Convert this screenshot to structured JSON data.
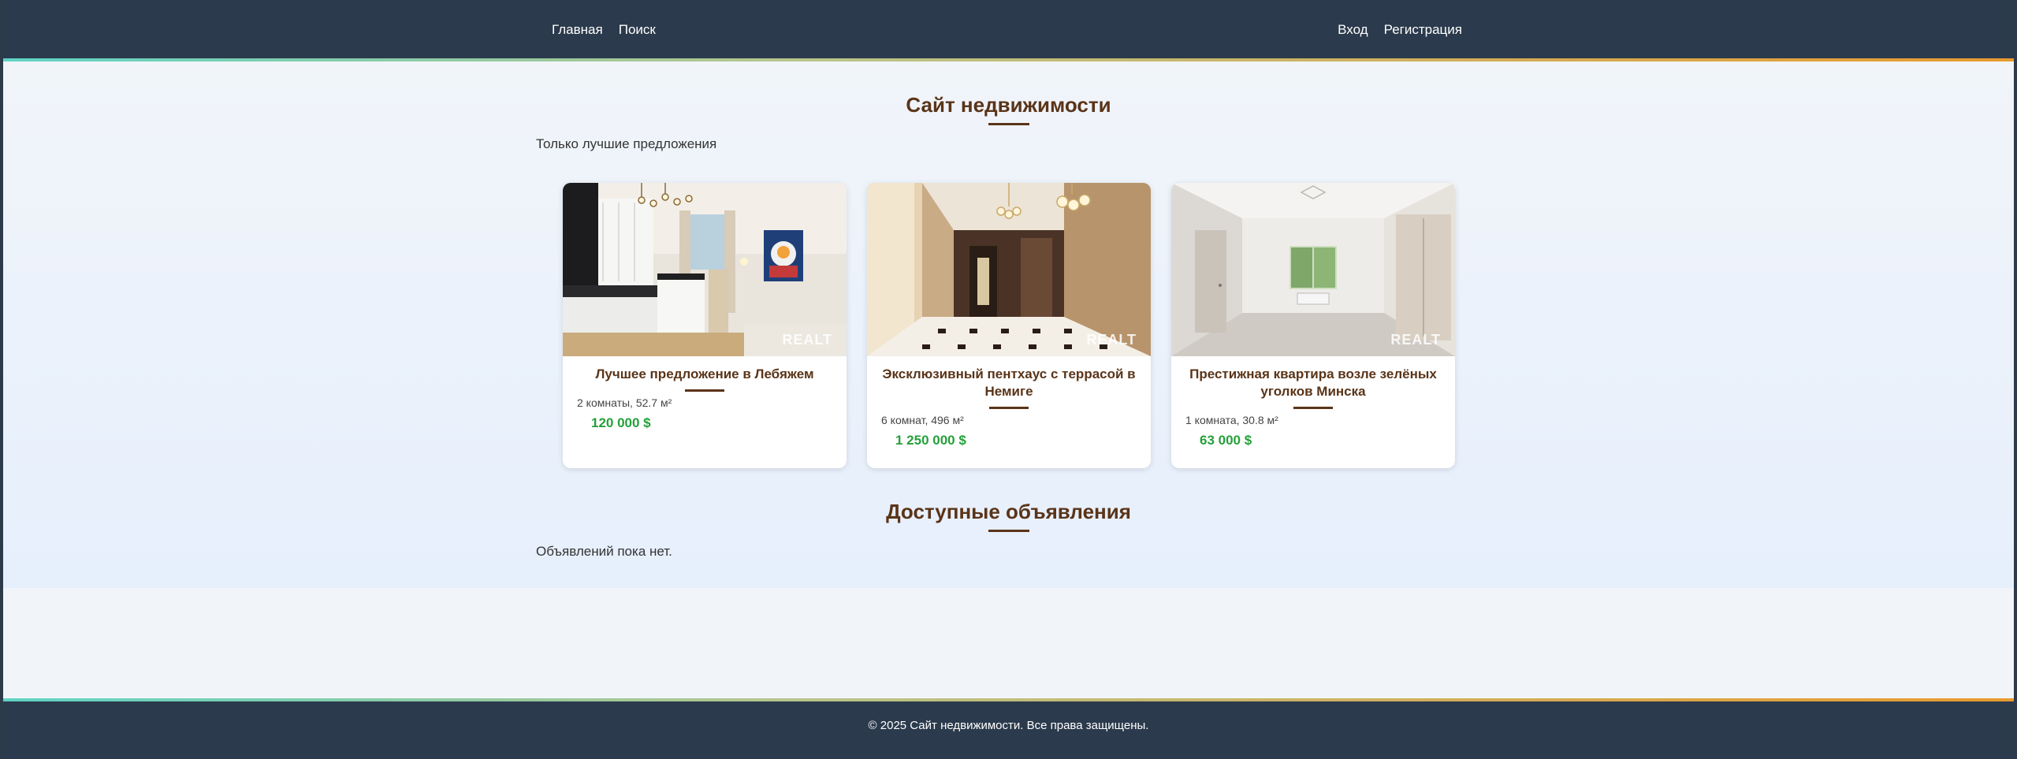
{
  "nav": {
    "home": "Главная",
    "search": "Поиск",
    "login": "Вход",
    "register": "Регистрация"
  },
  "hero": {
    "title": "Сайт недвижимости",
    "subtitle": "Только лучшие предложения"
  },
  "cards": [
    {
      "title": "Лучшее предложение в Лебяжем",
      "info": "2 комнаты, 52.7 м²",
      "price": "120 000 $",
      "watermark": "REALT"
    },
    {
      "title": "Эксклюзивный пентхаус с террасой в Немиге",
      "info": "6 комнат, 496 м²",
      "price": "1 250 000 $",
      "watermark": "REALT"
    },
    {
      "title": "Престижная квартира возле зелёных уголков Минска",
      "info": "1 комната, 30.8 м²",
      "price": "63 000 $",
      "watermark": "REALT"
    }
  ],
  "listings": {
    "title": "Доступные объявления",
    "empty": "Объявлений пока нет."
  },
  "footer": {
    "text": "© 2025 Сайт недвижимости. Все права защищены."
  },
  "colors": {
    "header": "#2b3a4c",
    "accent_brown": "#5a3418",
    "price_green": "#25a03a"
  }
}
